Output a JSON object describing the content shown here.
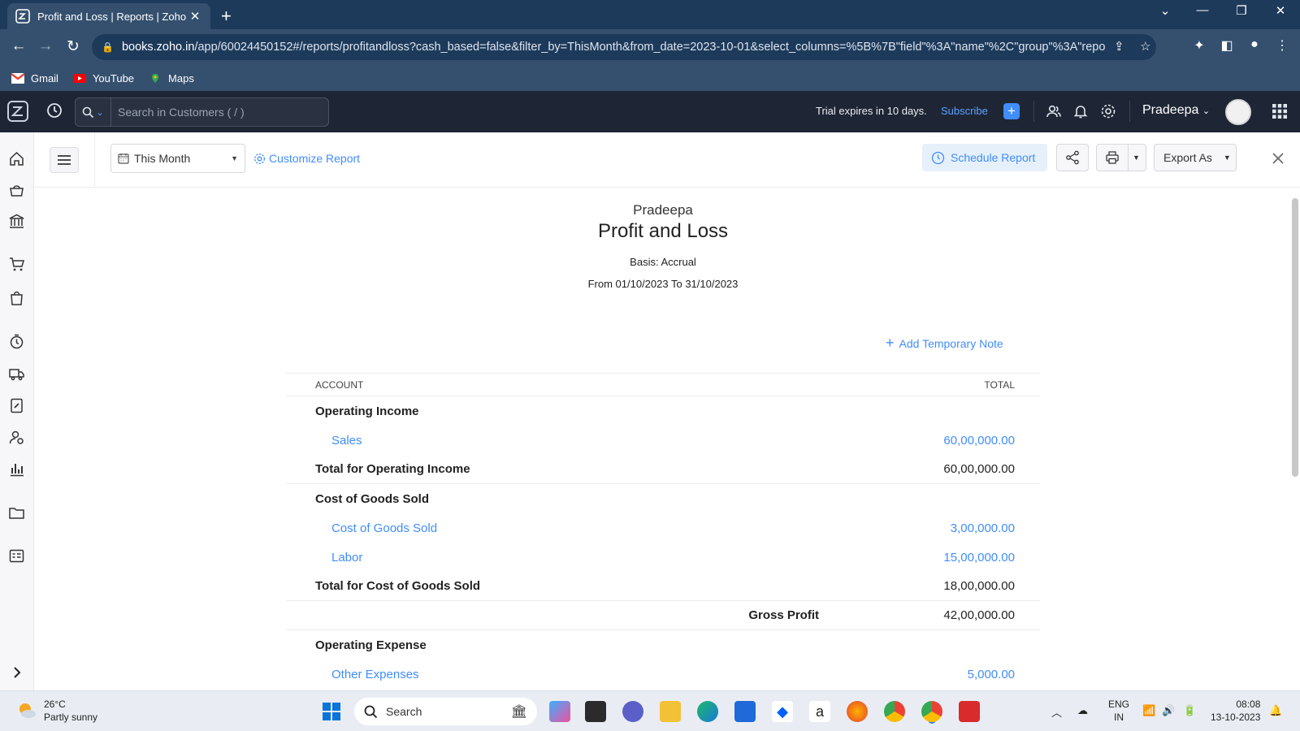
{
  "browser": {
    "tab_title": "Profit and Loss | Reports | Zoho Books",
    "url_host": "books.zoho.in",
    "url_path": "/app/60024450152#/reports/profitandloss?cash_based=false&filter_by=ThisMonth&from_date=2023-10-01&select_columns=%5B%7B\"field\"%3A\"name\"%2C\"group\"%3A\"repor...",
    "bookmarks": [
      {
        "label": "Gmail",
        "icon": "gmail-icon"
      },
      {
        "label": "YouTube",
        "icon": "youtube-icon"
      },
      {
        "label": "Maps",
        "icon": "maps-icon"
      }
    ]
  },
  "app_header": {
    "search_placeholder": "Search in Customers ( / )",
    "trial_text": "Trial expires in 10 days.",
    "subscribe_label": "Subscribe",
    "org_name": "Pradeepa"
  },
  "toolbar": {
    "period": "This Month",
    "customize_label": "Customize Report",
    "schedule_label": "Schedule Report",
    "export_label": "Export As"
  },
  "report": {
    "organization": "Pradeepa",
    "title": "Profit and Loss",
    "basis": "Basis: Accrual",
    "date_range": "From 01/10/2023 To 31/10/2023",
    "add_note_label": "Add Temporary Note",
    "columns": {
      "account": "ACCOUNT",
      "total": "TOTAL"
    },
    "rows": {
      "operating_income": {
        "label": "Operating Income"
      },
      "sales": {
        "label": "Sales",
        "amount": "60,00,000.00"
      },
      "total_operating_income": {
        "label": "Total for Operating Income",
        "amount": "60,00,000.00"
      },
      "cogs_section": {
        "label": "Cost of Goods Sold"
      },
      "cogs": {
        "label": "Cost of Goods Sold",
        "amount": "3,00,000.00"
      },
      "labor": {
        "label": "Labor",
        "amount": "15,00,000.00"
      },
      "total_cogs": {
        "label": "Total for Cost of Goods Sold",
        "amount": "18,00,000.00"
      },
      "gross_profit": {
        "label": "Gross Profit",
        "amount": "42,00,000.00"
      },
      "operating_expense": {
        "label": "Operating Expense"
      },
      "other_expenses": {
        "label": "Other Expenses",
        "amount": "5,000.00"
      }
    }
  },
  "taskbar": {
    "temperature": "26°C",
    "weather": "Partly sunny",
    "search_label": "Search",
    "lang_line1": "ENG",
    "lang_line2": "IN",
    "time": "08:08",
    "date": "13-10-2023"
  },
  "colors": {
    "accent": "#408dfb",
    "header_bg": "#1e2636",
    "browser_bg": "#35506f"
  }
}
